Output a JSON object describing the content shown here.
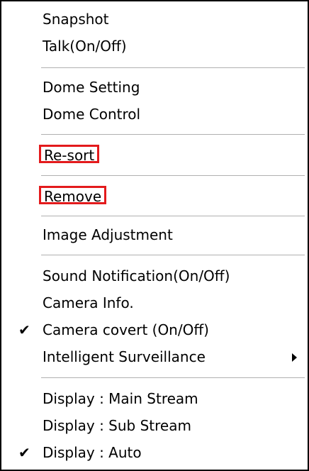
{
  "menu": {
    "items": [
      {
        "label": "Snapshot"
      },
      {
        "label": "Talk(On/Off)"
      },
      {
        "label": "Dome Setting"
      },
      {
        "label": "Dome Control"
      },
      {
        "label": "Re-sort"
      },
      {
        "label": "Remove"
      },
      {
        "label": "Image Adjustment"
      },
      {
        "label": "Sound Notification(On/Off)"
      },
      {
        "label": "Camera Info."
      },
      {
        "label": "Camera covert (On/Off)",
        "check": "✔"
      },
      {
        "label": "Intelligent Surveillance"
      },
      {
        "label": "Display : Main Stream"
      },
      {
        "label": "Display : Sub Stream"
      },
      {
        "label": "Display : Auto",
        "check": "✔"
      }
    ]
  },
  "colors": {
    "highlight_box": "#e31a1c",
    "separator": "#b0b0b0"
  },
  "icons": {
    "check": "checkmark-icon",
    "submenu": "submenu-arrow-icon"
  }
}
